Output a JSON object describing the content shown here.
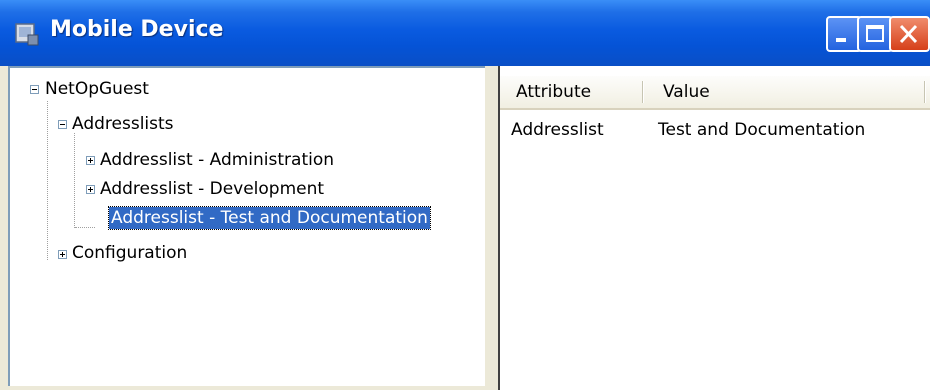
{
  "window": {
    "title": "Mobile Device",
    "colors": {
      "titlebar": "#0a5be0",
      "selection": "#316ac5",
      "close": "#d6401a"
    }
  },
  "title_buttons": {
    "minimize_icon": "minimize-icon",
    "maximize_icon": "maximize-icon",
    "close_icon": "close-icon"
  },
  "tree": {
    "root": {
      "label": "NetOpGuest",
      "expanded": true
    },
    "addresslists": {
      "label": "Addresslists",
      "expanded": true
    },
    "children": [
      {
        "label": "Addresslist - Administration",
        "expanded": false
      },
      {
        "label": "Addresslist -  Development",
        "expanded": false
      },
      {
        "label": "Addresslist - Test and Documentation",
        "selected": true
      }
    ],
    "configuration": {
      "label": "Configuration",
      "expanded": false
    }
  },
  "list": {
    "columns": [
      "Attribute",
      "Value"
    ],
    "rows": [
      {
        "attribute": "Addresslist",
        "value": "Test and Documentation"
      }
    ]
  }
}
